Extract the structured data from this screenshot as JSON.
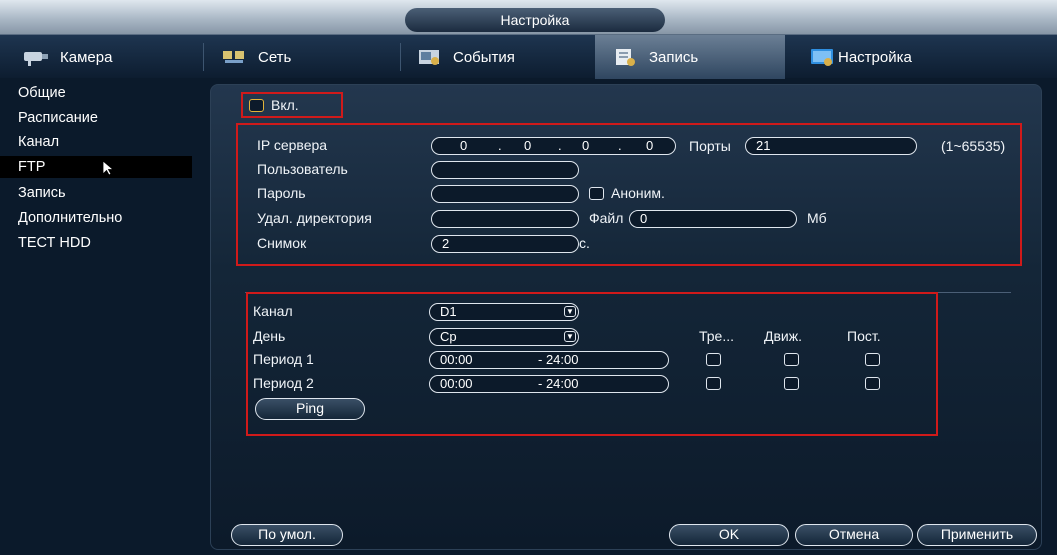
{
  "window": {
    "title": "Настройка"
  },
  "tabs": [
    {
      "label": "Камера",
      "icon": "camera-icon"
    },
    {
      "label": "Сеть",
      "icon": "network-icon"
    },
    {
      "label": "События",
      "icon": "events-icon"
    },
    {
      "label": "Запись",
      "icon": "record-icon"
    },
    {
      "label": "Настройка",
      "icon": "settings-icon"
    }
  ],
  "active_tab": "Запись",
  "sidebar": {
    "items": [
      {
        "label": "Общие"
      },
      {
        "label": "Расписание"
      },
      {
        "label": "Канал"
      },
      {
        "label": "FTP"
      },
      {
        "label": "Запись"
      },
      {
        "label": "Дополнительно"
      },
      {
        "label": "ТЕСТ HDD"
      }
    ],
    "selected": "FTP"
  },
  "ftp": {
    "enable_label": "Вкл.",
    "server_ip_label": "IP сервера",
    "server_ip": [
      "0",
      "0",
      "0",
      "0"
    ],
    "port_label": "Порты",
    "port_value": "21",
    "port_range": "(1~65535)",
    "user_label": "Пользователь",
    "user_value": "",
    "password_label": "Пароль",
    "password_value": "",
    "anonymous_label": "Аноним.",
    "remote_dir_label": "Удал. директория",
    "remote_dir_value": "",
    "file_label": "Файл",
    "file_value": "0",
    "file_unit": "Мб",
    "snapshot_label": "Снимок",
    "snapshot_value": "2",
    "snapshot_unit": "с."
  },
  "schedule": {
    "channel_label": "Канал",
    "channel_value": "D1",
    "day_label": "День",
    "day_value": "Ср",
    "col_alarm": "Тре...",
    "col_motion": "Движ.",
    "col_regular": "Пост.",
    "periods": [
      {
        "label": "Период 1",
        "start": "00:00",
        "end": "- 24:00"
      },
      {
        "label": "Период 2",
        "start": "00:00",
        "end": "- 24:00"
      }
    ],
    "ping_label": "Ping"
  },
  "footer": {
    "default_label": "По умол.",
    "ok_label": "OK",
    "cancel_label": "Отмена",
    "apply_label": "Применить"
  },
  "colors": {
    "highlight_box": "#d01a1a",
    "background": "#0b1a2b",
    "enable_checkbox": "#e2b43a"
  }
}
